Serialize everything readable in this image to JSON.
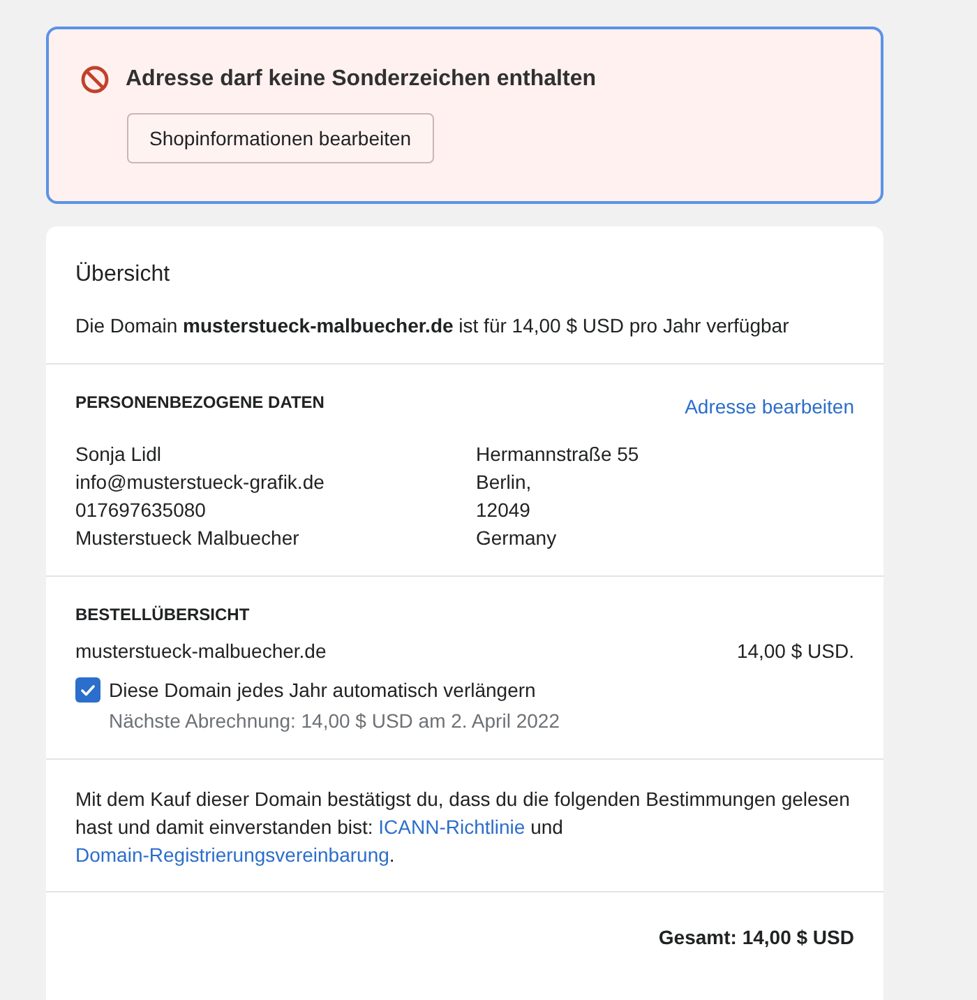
{
  "error_banner": {
    "message": "Adresse darf keine Sonderzeichen enthalten",
    "button": "Shopinformationen bearbeiten"
  },
  "overview": {
    "title": "Übersicht",
    "text": "Die Domain **musterstueck-malbuecher.de** ist für 14,00 $ USD pro Jahr verfügbar"
  },
  "personal_data": {
    "heading": "PERSONENBEZOGENE DATEN",
    "edit_link": "Adresse bearbeiten",
    "contact": [
      "Sonja Lidl",
      "info@musterstueck-grafik.de",
      "017697635080",
      "Musterstueck Malbuecher"
    ],
    "address": [
      "Hermannstraße 55",
      "Berlin,",
      "12049",
      "Germany"
    ]
  },
  "order_summary": {
    "heading": "BESTELLÜBERSICHT",
    "domain": "musterstueck-malbuecher.de",
    "price": "14,00 $ USD.",
    "auto_renew": {
      "label": "Diese Domain jedes Jahr automatisch verlängern",
      "checked": true,
      "note": "Nächste Abrechnung: 14,00 $ USD am 2. April 2022"
    }
  },
  "terms": [
    {
      "kind": "text",
      "text": "Mit dem Kauf dieser Domain bestätigst du, dass du die folgenden Bestimmungen gelesen hast und damit einverstanden bist:"
    },
    {
      "kind": "link",
      "text": "ICANN-Richtlinie"
    },
    {
      "kind": "text",
      "text": "und"
    },
    {
      "kind": "link",
      "text": "Domain-Registrierungsvereinbarung"
    },
    {
      "kind": "text",
      "text": "."
    }
  ],
  "total": "Gesamt: 14,00 $ USD"
}
